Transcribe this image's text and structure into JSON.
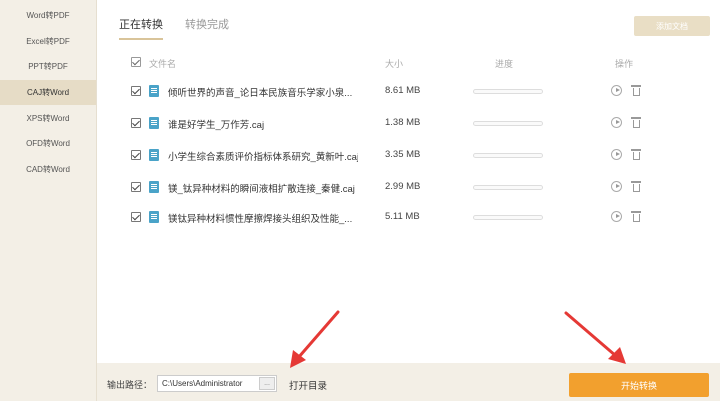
{
  "sidebar": {
    "items": [
      {
        "label": "Word转PDF"
      },
      {
        "label": "Excel转PDF"
      },
      {
        "label": "PPT转PDF"
      },
      {
        "label": "CAJ转Word"
      },
      {
        "label": "XPS转Word"
      },
      {
        "label": "OFD转Word"
      },
      {
        "label": "CAD转Word"
      }
    ]
  },
  "tabs": [
    {
      "label": "正在转换"
    },
    {
      "label": "转换完成"
    }
  ],
  "toolbar": {
    "add_label": "添加文档"
  },
  "table": {
    "headers": {
      "name": "文件名",
      "size": "大小",
      "progress": "进度",
      "action": "操作"
    },
    "rows": [
      {
        "name": "倾听世界的声音_论日本民族音乐学家小泉...",
        "size": "8.61 MB",
        "progress": 0
      },
      {
        "name": "谁是好学生_万作芳.caj",
        "size": "1.38 MB",
        "progress": 0
      },
      {
        "name": "小学生综合素质评价指标体系研究_黄新叶.caj",
        "size": "3.35 MB",
        "progress": 0
      },
      {
        "name": "镁_钛异种材料的瞬间液相扩散连接_秦健.caj",
        "size": "2.99 MB",
        "progress": 0
      },
      {
        "name": "镁钛异种材料惯性摩擦焊接头组织及性能_...",
        "size": "5.11 MB",
        "progress": 0
      }
    ]
  },
  "bottom": {
    "output_label": "输出路径：",
    "output_path": "C:\\Users\\Administrator",
    "browse_label": "...",
    "open_dir_label": "打开目录",
    "start_label": "开始转换"
  },
  "colors": {
    "accent": "#f2a02e",
    "annotation_arrow": "#e53935"
  }
}
